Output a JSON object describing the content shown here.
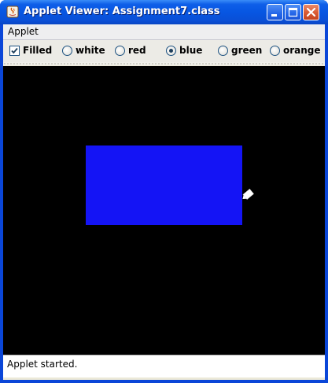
{
  "window": {
    "title": "Applet Viewer: Assignment7.class"
  },
  "menubar": {
    "items": [
      {
        "label": "Applet"
      }
    ]
  },
  "controls": {
    "filled": {
      "label": "Filled",
      "checked": true
    },
    "colors": [
      {
        "label": "white",
        "selected": false
      },
      {
        "label": "red",
        "selected": false
      },
      {
        "label": "blue",
        "selected": true
      },
      {
        "label": "green",
        "selected": false
      },
      {
        "label": "orange",
        "selected": false
      }
    ]
  },
  "canvas": {
    "background": "#000000",
    "shape": {
      "type": "filled-rectangle",
      "color": "#1414f5"
    }
  },
  "status": {
    "text": "Applet started."
  }
}
